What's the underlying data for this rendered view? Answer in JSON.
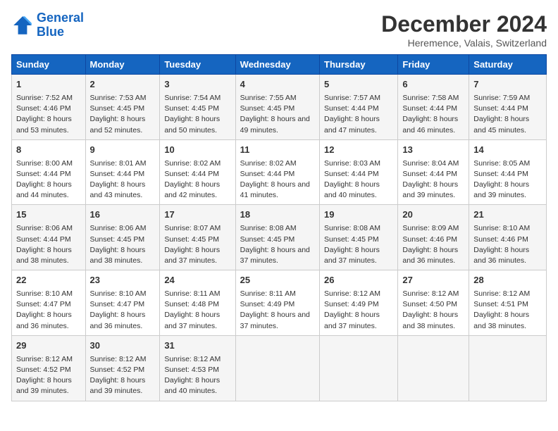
{
  "header": {
    "logo_line1": "General",
    "logo_line2": "Blue",
    "title": "December 2024",
    "subtitle": "Heremence, Valais, Switzerland"
  },
  "columns": [
    "Sunday",
    "Monday",
    "Tuesday",
    "Wednesday",
    "Thursday",
    "Friday",
    "Saturday"
  ],
  "weeks": [
    [
      {
        "day": "1",
        "sunrise": "Sunrise: 7:52 AM",
        "sunset": "Sunset: 4:46 PM",
        "daylight": "Daylight: 8 hours and 53 minutes."
      },
      {
        "day": "2",
        "sunrise": "Sunrise: 7:53 AM",
        "sunset": "Sunset: 4:45 PM",
        "daylight": "Daylight: 8 hours and 52 minutes."
      },
      {
        "day": "3",
        "sunrise": "Sunrise: 7:54 AM",
        "sunset": "Sunset: 4:45 PM",
        "daylight": "Daylight: 8 hours and 50 minutes."
      },
      {
        "day": "4",
        "sunrise": "Sunrise: 7:55 AM",
        "sunset": "Sunset: 4:45 PM",
        "daylight": "Daylight: 8 hours and 49 minutes."
      },
      {
        "day": "5",
        "sunrise": "Sunrise: 7:57 AM",
        "sunset": "Sunset: 4:44 PM",
        "daylight": "Daylight: 8 hours and 47 minutes."
      },
      {
        "day": "6",
        "sunrise": "Sunrise: 7:58 AM",
        "sunset": "Sunset: 4:44 PM",
        "daylight": "Daylight: 8 hours and 46 minutes."
      },
      {
        "day": "7",
        "sunrise": "Sunrise: 7:59 AM",
        "sunset": "Sunset: 4:44 PM",
        "daylight": "Daylight: 8 hours and 45 minutes."
      }
    ],
    [
      {
        "day": "8",
        "sunrise": "Sunrise: 8:00 AM",
        "sunset": "Sunset: 4:44 PM",
        "daylight": "Daylight: 8 hours and 44 minutes."
      },
      {
        "day": "9",
        "sunrise": "Sunrise: 8:01 AM",
        "sunset": "Sunset: 4:44 PM",
        "daylight": "Daylight: 8 hours and 43 minutes."
      },
      {
        "day": "10",
        "sunrise": "Sunrise: 8:02 AM",
        "sunset": "Sunset: 4:44 PM",
        "daylight": "Daylight: 8 hours and 42 minutes."
      },
      {
        "day": "11",
        "sunrise": "Sunrise: 8:02 AM",
        "sunset": "Sunset: 4:44 PM",
        "daylight": "Daylight: 8 hours and 41 minutes."
      },
      {
        "day": "12",
        "sunrise": "Sunrise: 8:03 AM",
        "sunset": "Sunset: 4:44 PM",
        "daylight": "Daylight: 8 hours and 40 minutes."
      },
      {
        "day": "13",
        "sunrise": "Sunrise: 8:04 AM",
        "sunset": "Sunset: 4:44 PM",
        "daylight": "Daylight: 8 hours and 39 minutes."
      },
      {
        "day": "14",
        "sunrise": "Sunrise: 8:05 AM",
        "sunset": "Sunset: 4:44 PM",
        "daylight": "Daylight: 8 hours and 39 minutes."
      }
    ],
    [
      {
        "day": "15",
        "sunrise": "Sunrise: 8:06 AM",
        "sunset": "Sunset: 4:44 PM",
        "daylight": "Daylight: 8 hours and 38 minutes."
      },
      {
        "day": "16",
        "sunrise": "Sunrise: 8:06 AM",
        "sunset": "Sunset: 4:45 PM",
        "daylight": "Daylight: 8 hours and 38 minutes."
      },
      {
        "day": "17",
        "sunrise": "Sunrise: 8:07 AM",
        "sunset": "Sunset: 4:45 PM",
        "daylight": "Daylight: 8 hours and 37 minutes."
      },
      {
        "day": "18",
        "sunrise": "Sunrise: 8:08 AM",
        "sunset": "Sunset: 4:45 PM",
        "daylight": "Daylight: 8 hours and 37 minutes."
      },
      {
        "day": "19",
        "sunrise": "Sunrise: 8:08 AM",
        "sunset": "Sunset: 4:45 PM",
        "daylight": "Daylight: 8 hours and 37 minutes."
      },
      {
        "day": "20",
        "sunrise": "Sunrise: 8:09 AM",
        "sunset": "Sunset: 4:46 PM",
        "daylight": "Daylight: 8 hours and 36 minutes."
      },
      {
        "day": "21",
        "sunrise": "Sunrise: 8:10 AM",
        "sunset": "Sunset: 4:46 PM",
        "daylight": "Daylight: 8 hours and 36 minutes."
      }
    ],
    [
      {
        "day": "22",
        "sunrise": "Sunrise: 8:10 AM",
        "sunset": "Sunset: 4:47 PM",
        "daylight": "Daylight: 8 hours and 36 minutes."
      },
      {
        "day": "23",
        "sunrise": "Sunrise: 8:10 AM",
        "sunset": "Sunset: 4:47 PM",
        "daylight": "Daylight: 8 hours and 36 minutes."
      },
      {
        "day": "24",
        "sunrise": "Sunrise: 8:11 AM",
        "sunset": "Sunset: 4:48 PM",
        "daylight": "Daylight: 8 hours and 37 minutes."
      },
      {
        "day": "25",
        "sunrise": "Sunrise: 8:11 AM",
        "sunset": "Sunset: 4:49 PM",
        "daylight": "Daylight: 8 hours and 37 minutes."
      },
      {
        "day": "26",
        "sunrise": "Sunrise: 8:12 AM",
        "sunset": "Sunset: 4:49 PM",
        "daylight": "Daylight: 8 hours and 37 minutes."
      },
      {
        "day": "27",
        "sunrise": "Sunrise: 8:12 AM",
        "sunset": "Sunset: 4:50 PM",
        "daylight": "Daylight: 8 hours and 38 minutes."
      },
      {
        "day": "28",
        "sunrise": "Sunrise: 8:12 AM",
        "sunset": "Sunset: 4:51 PM",
        "daylight": "Daylight: 8 hours and 38 minutes."
      }
    ],
    [
      {
        "day": "29",
        "sunrise": "Sunrise: 8:12 AM",
        "sunset": "Sunset: 4:52 PM",
        "daylight": "Daylight: 8 hours and 39 minutes."
      },
      {
        "day": "30",
        "sunrise": "Sunrise: 8:12 AM",
        "sunset": "Sunset: 4:52 PM",
        "daylight": "Daylight: 8 hours and 39 minutes."
      },
      {
        "day": "31",
        "sunrise": "Sunrise: 8:12 AM",
        "sunset": "Sunset: 4:53 PM",
        "daylight": "Daylight: 8 hours and 40 minutes."
      },
      null,
      null,
      null,
      null
    ]
  ]
}
